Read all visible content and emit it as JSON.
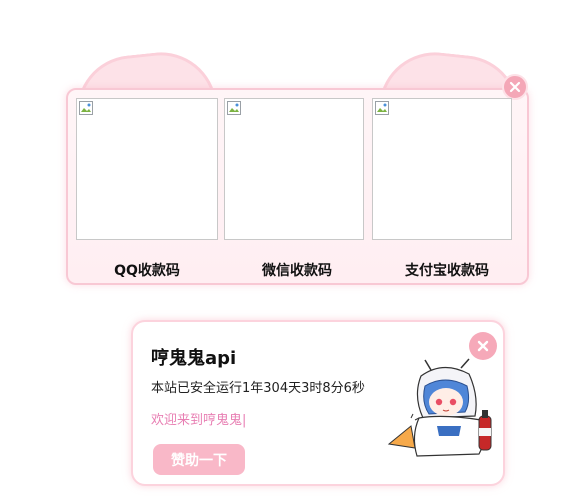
{
  "donate_panel": {
    "close_icon": "close-icon",
    "qr_codes": [
      {
        "label": "QQ收款码",
        "icon": "broken-image-icon"
      },
      {
        "label": "微信收款码",
        "icon": "broken-image-icon"
      },
      {
        "label": "支付宝收款码",
        "icon": "broken-image-icon"
      }
    ]
  },
  "info_card": {
    "title": "哼鬼鬼api",
    "uptime": "本站已安全运行1年304天3时8分6秒",
    "welcome": "欢迎来到哼鬼鬼",
    "cursor": "|",
    "sponsor_button": "赞助一下",
    "close_icon": "close-icon",
    "mascot_icon": "anime-mascot-image"
  },
  "colors": {
    "accent_pink": "#f4a7b7",
    "welcome_text": "#e87fb3",
    "panel_border": "#f8c8d4"
  }
}
